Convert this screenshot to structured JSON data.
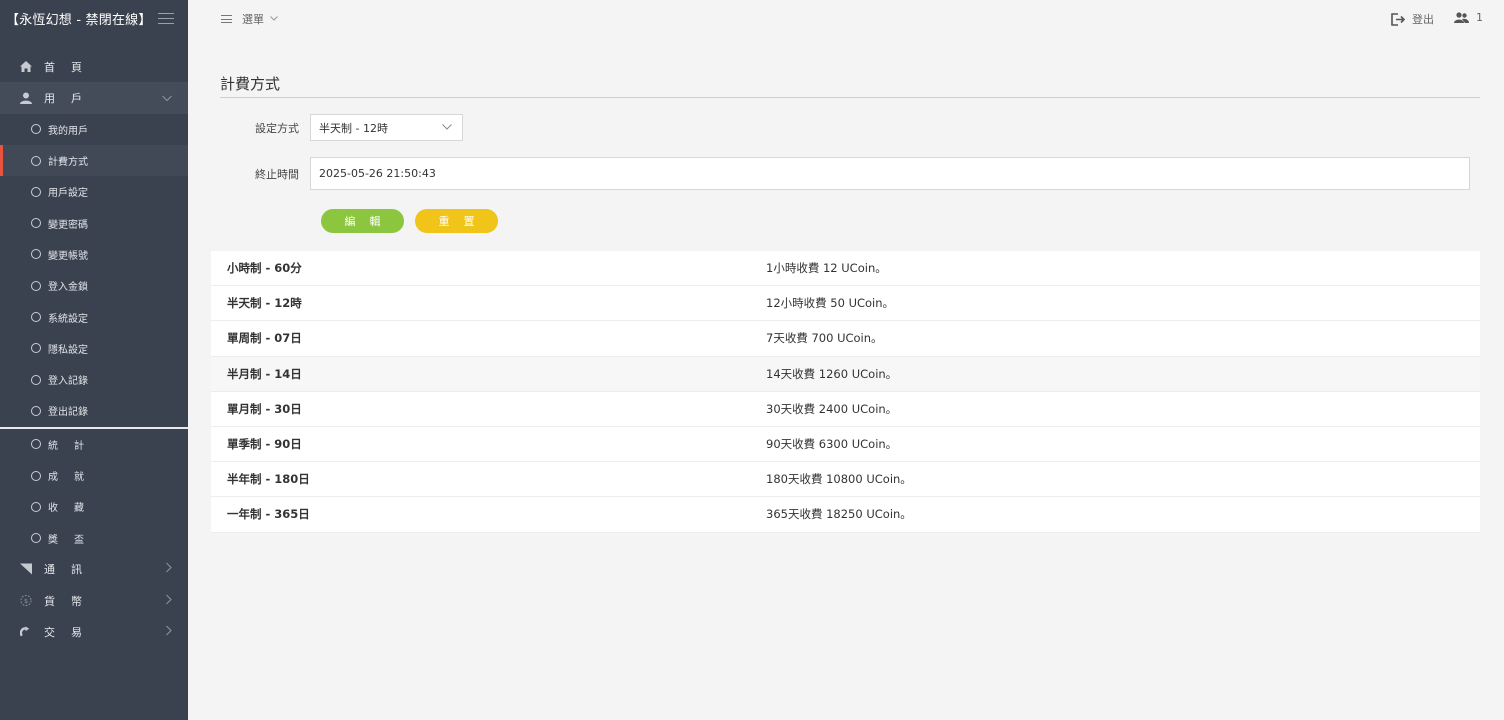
{
  "app": {
    "title": "【永恆幻想 - 禁閉在線】"
  },
  "topbar": {
    "menu_label": "選單",
    "logout_label": "登出",
    "user_count": "1"
  },
  "sidebar": {
    "items": [
      {
        "label": "首頁",
        "icon": "home-icon"
      },
      {
        "label": "用戶",
        "icon": "user-icon"
      }
    ],
    "sub_items": [
      {
        "label": "我的用戶"
      },
      {
        "label": "計費方式"
      },
      {
        "label": "用戶設定"
      },
      {
        "label": "變更密碼"
      },
      {
        "label": "變更帳號"
      },
      {
        "label": "登入金鎖"
      },
      {
        "label": "系統設定"
      },
      {
        "label": "隱私設定"
      },
      {
        "label": "登入記錄"
      },
      {
        "label": "登出記錄"
      }
    ],
    "extra_items": [
      {
        "label": "統計"
      },
      {
        "label": "成就"
      },
      {
        "label": "收藏"
      },
      {
        "label": "獎盃"
      }
    ],
    "bottom_items": [
      {
        "label": "通訊",
        "icon": "signal-icon"
      },
      {
        "label": "貨幣",
        "icon": "currency-icon"
      },
      {
        "label": "交易",
        "icon": "exchange-icon"
      }
    ]
  },
  "page": {
    "title": "計費方式",
    "form": {
      "method_label": "設定方式",
      "method_value": "半天制 - 12時",
      "end_label": "終止時間",
      "end_value": "2025-05-26 21:50:43"
    },
    "buttons": {
      "edit": "編輯",
      "reset": "重置"
    },
    "plans": [
      {
        "name": "小時制 - 60分",
        "desc": "1小時收費 12 UCoin。"
      },
      {
        "name": "半天制 - 12時",
        "desc": "12小時收費 50 UCoin。"
      },
      {
        "name": "單周制 - 07日",
        "desc": "7天收費 700 UCoin。"
      },
      {
        "name": "半月制 - 14日",
        "desc": "14天收費 1260 UCoin。"
      },
      {
        "name": "單月制 - 30日",
        "desc": "30天收費 2400 UCoin。"
      },
      {
        "name": "單季制 - 90日",
        "desc": "90天收費 6300 UCoin。"
      },
      {
        "name": "半年制 - 180日",
        "desc": "180天收費 10800 UCoin。"
      },
      {
        "name": "一年制 - 365日",
        "desc": "365天收費 18250 UCoin。"
      }
    ]
  }
}
